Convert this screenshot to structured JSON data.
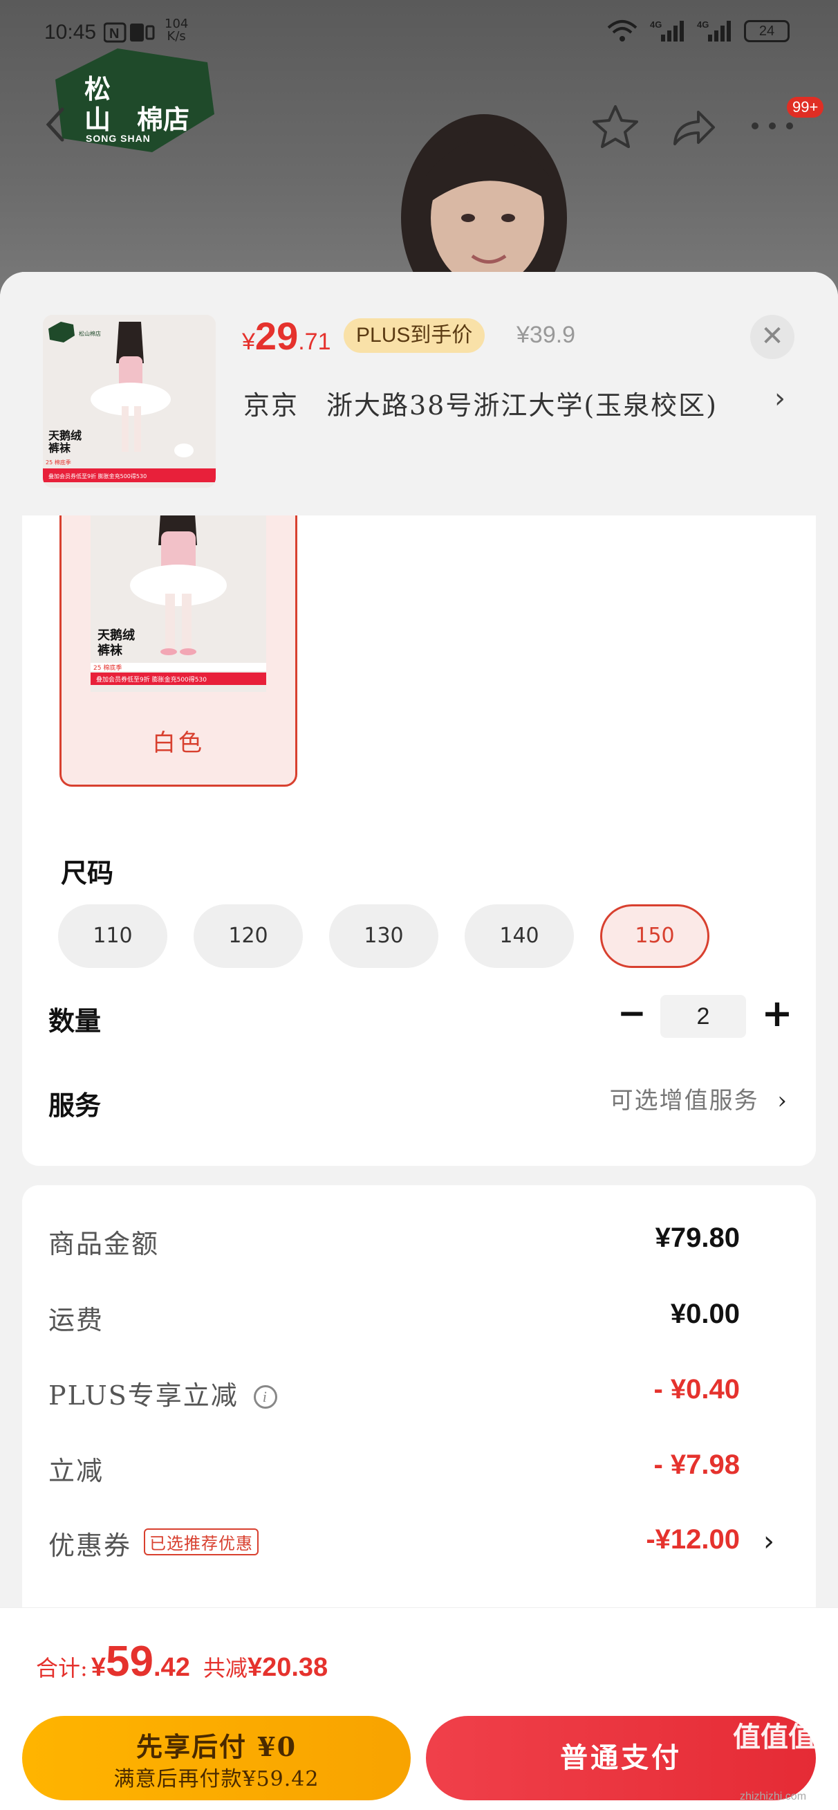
{
  "status_bar": {
    "time": "10:45",
    "net_speed_value": "104",
    "net_speed_unit": "K/s",
    "net_type_1": "4G",
    "net_type_2": "4G",
    "battery": "24"
  },
  "store_logo": {
    "line1": "松",
    "line2a": "山",
    "line2b": "棉店",
    "sub": "SONG SHAN"
  },
  "top_nav": {
    "badge": "99+"
  },
  "sheet_header": {
    "price_symbol": "¥",
    "price_int": "29",
    "price_dec": ".71",
    "plus_tag": "PLUS到手价",
    "original_price": "¥39.9",
    "close_label": "✕",
    "address": "京京　浙大路38号浙江大学(玉泉校区)",
    "address_chevron": "›"
  },
  "product_image": {
    "mini_logo": "松山棉店",
    "caption_line1": "天鹅绒",
    "caption_line2": "裤袜",
    "promo_season": "25 棉底季",
    "promo_banner": "叠加会员券低至9折  膨胀金充500得530"
  },
  "color_option": {
    "label": "白色"
  },
  "size_section": {
    "title": "尺码",
    "options": [
      "110",
      "120",
      "130",
      "140",
      "150"
    ],
    "selected": "150"
  },
  "quantity": {
    "title": "数量",
    "minus": "−",
    "value": "2",
    "plus": "+"
  },
  "service": {
    "title": "服务",
    "hint": "可选增值服务",
    "chevron": "›"
  },
  "summary": {
    "rows": [
      {
        "label": "商品金额",
        "value": "¥79.80"
      },
      {
        "label": "运费",
        "value": "¥0.00"
      },
      {
        "label": "PLUS专享立减",
        "info_icon": "i",
        "value": "- ¥0.40"
      },
      {
        "label": "立减",
        "value": "- ¥7.98"
      },
      {
        "label": "优惠券",
        "tag": "已选推荐优惠",
        "value": "-¥12.00",
        "chevron": "›"
      }
    ]
  },
  "footer": {
    "total_label": "合计:",
    "total_symbol": "¥",
    "total_int": "59",
    "total_dec": ".42",
    "reduced_label": "共减",
    "reduced_value": "¥20.38",
    "pay_later_line1": "先享后付 ¥0",
    "pay_later_line2": "满意后再付款¥59.42",
    "pay_normal": "普通支付"
  },
  "watermark": {
    "text": "值值值",
    "url": "zhizhizhi.com"
  },
  "colors": {
    "accent_red": "#e5322d",
    "plus_gold": "#f9e1a8",
    "pay_later_orange": "#ffb400",
    "pay_red": "#e52b35"
  }
}
